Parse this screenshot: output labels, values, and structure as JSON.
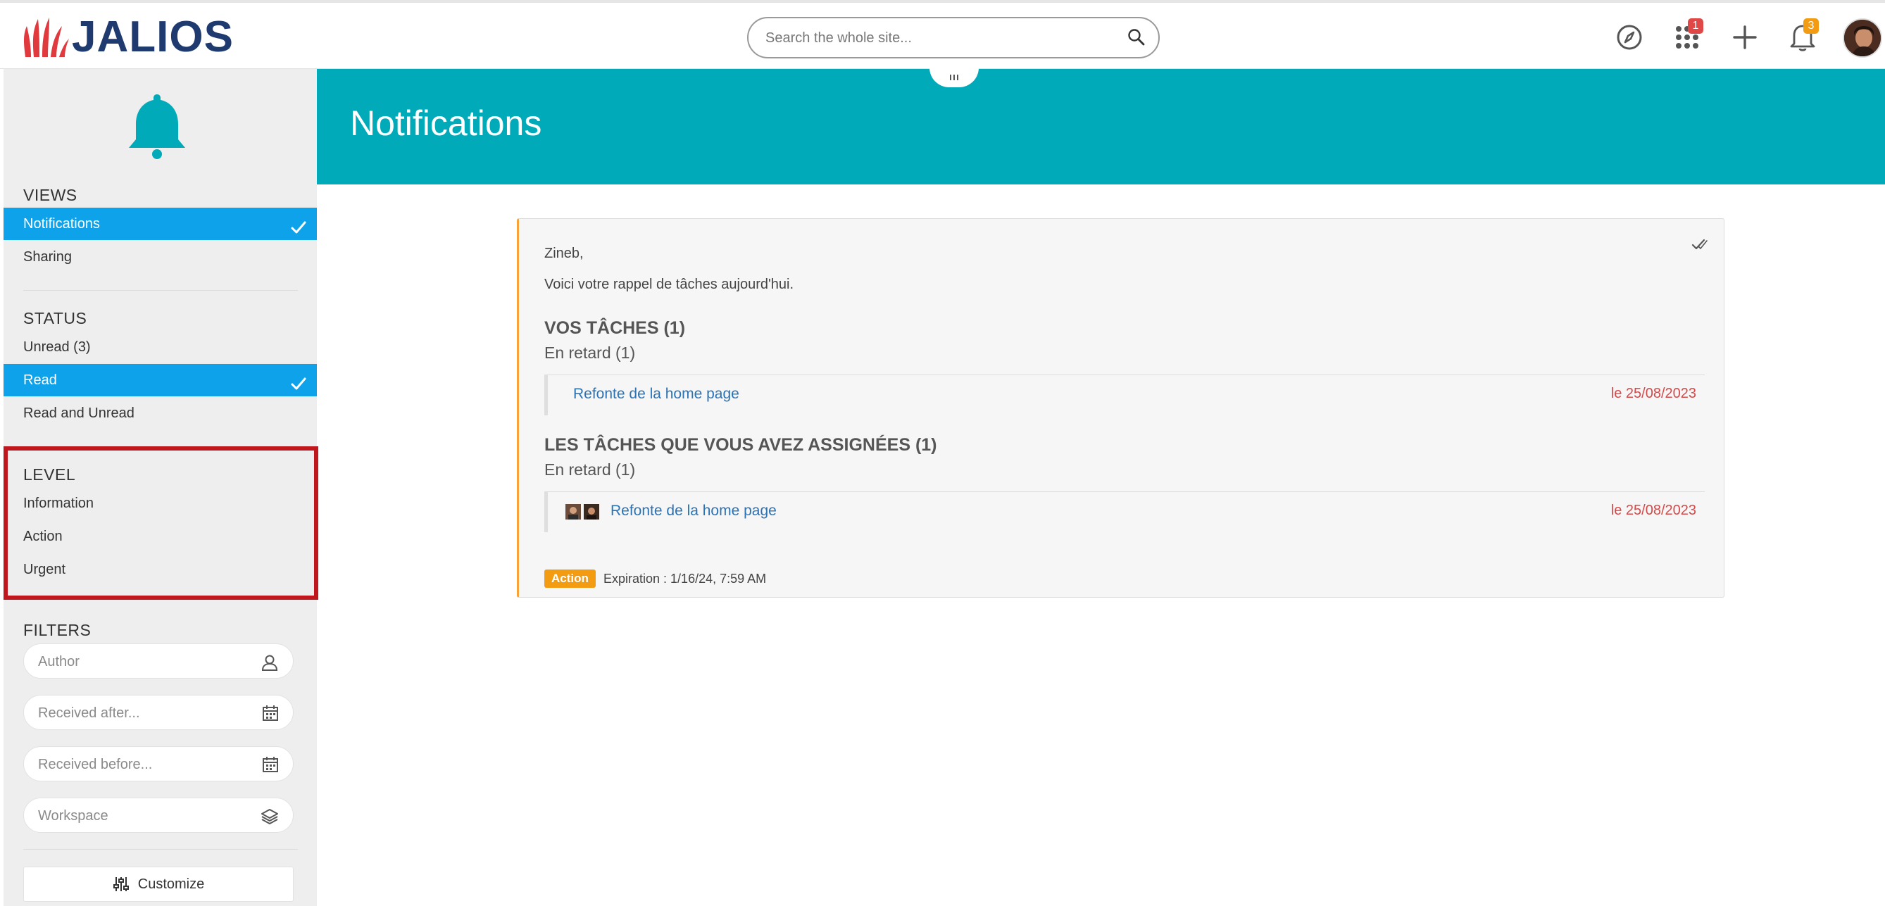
{
  "header": {
    "logo_text": "JALIOS",
    "search_placeholder": "Search the whole site...",
    "apps_badge": "1",
    "notifications_badge": "3",
    "colors": {
      "logo_red": "#e03a3e",
      "logo_blue": "#1e3a6e",
      "apps_badge": "#e04848",
      "notif_badge": "#f39c12"
    }
  },
  "sidebar": {
    "views": {
      "title": "VIEWS",
      "items": [
        {
          "label": "Notifications",
          "active": true
        },
        {
          "label": "Sharing",
          "active": false
        }
      ]
    },
    "status": {
      "title": "STATUS",
      "items": [
        {
          "label": "Unread (3)",
          "active": false
        },
        {
          "label": "Read",
          "active": true
        },
        {
          "label": "Read and Unread",
          "active": false
        }
      ]
    },
    "level": {
      "title": "LEVEL",
      "items": [
        {
          "label": "Information"
        },
        {
          "label": "Action"
        },
        {
          "label": "Urgent"
        }
      ]
    },
    "filters": {
      "title": "FILTERS",
      "author_placeholder": "Author",
      "received_after_placeholder": "Received after...",
      "received_before_placeholder": "Received before...",
      "workspace_placeholder": "Workspace"
    },
    "customize_label": "Customize",
    "colors": {
      "active": "#0ea2ea",
      "highlight": "#c0161e",
      "bell": "#00aab9"
    }
  },
  "main": {
    "title": "Notifications",
    "banner_color": "#00aab9",
    "notification": {
      "greeting": "Zineb,",
      "intro": "Voici votre rappel de tâches aujourd'hui.",
      "section1_title": "VOS TÂCHES (1)",
      "section1_sub": "En retard (1)",
      "section1_task": {
        "label": "Refonte de la home page",
        "date": "le 25/08/2023"
      },
      "section2_title": "LES TÂCHES QUE VOUS AVEZ ASSIGNÉES (1)",
      "section2_sub": "En retard (1)",
      "section2_task": {
        "label": "Refonte de la home page",
        "date": "le 25/08/2023"
      },
      "level_badge": "Action",
      "expiration": "Expiration : 1/16/24, 7:59 AM"
    }
  }
}
